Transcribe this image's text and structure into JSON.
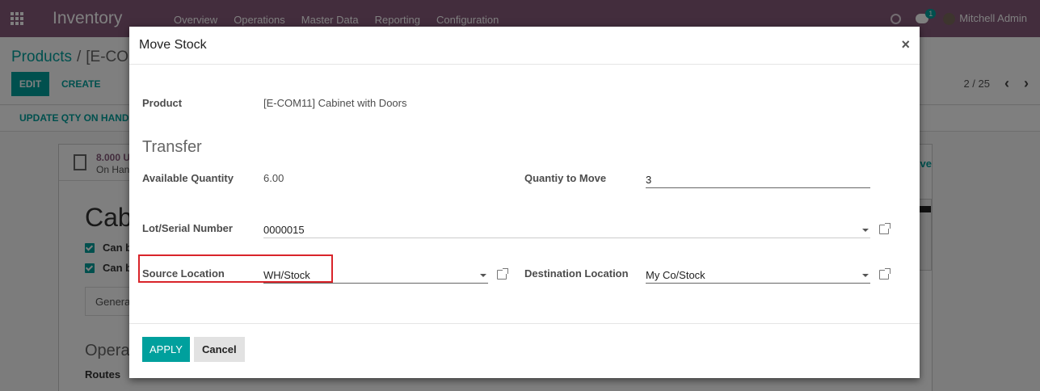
{
  "topbar": {
    "app_name": "Inventory",
    "menu": [
      "Overview",
      "Operations",
      "Master Data",
      "Reporting",
      "Configuration"
    ],
    "chat_count": "1",
    "user_name": "Mitchell Admin"
  },
  "control_panel": {
    "breadcrumb_parent": "Products",
    "breadcrumb_current": "[E-COM",
    "edit_label": "EDIT",
    "create_label": "CREATE",
    "pager_value": "2 / 25"
  },
  "statusbar": {
    "update_qty_label": "UPDATE QTY ON HAND"
  },
  "sheet": {
    "on_hand_value": "8.000 U",
    "on_hand_label": "On Han",
    "archive_label": "ve",
    "product_name": "Cab",
    "checkbox_1": "Can b",
    "checkbox_2": "Can b",
    "general_tab": "Genera",
    "section_title": "Operat",
    "routes_label": "Routes"
  },
  "modal": {
    "title": "Move Stock",
    "close_symbol": "×",
    "product_label": "Product",
    "product_value": "[E-COM11] Cabinet with Doors",
    "transfer_title": "Transfer",
    "available_qty_label": "Available Quantity",
    "available_qty_value": "6.00",
    "qty_to_move_label": "Quantiy to Move",
    "qty_to_move_value": "3",
    "lot_label": "Lot/Serial Number",
    "lot_value": "0000015",
    "source_location_label": "Source Location",
    "source_location_value": "WH/Stock",
    "destination_location_label": "Destination Location",
    "destination_location_value": "My Co/Stock",
    "apply_label": "APPLY",
    "cancel_label": "Cancel"
  },
  "colors": {
    "brand": "#875a7b",
    "accent": "#00a09d",
    "highlight": "#d9242a"
  }
}
